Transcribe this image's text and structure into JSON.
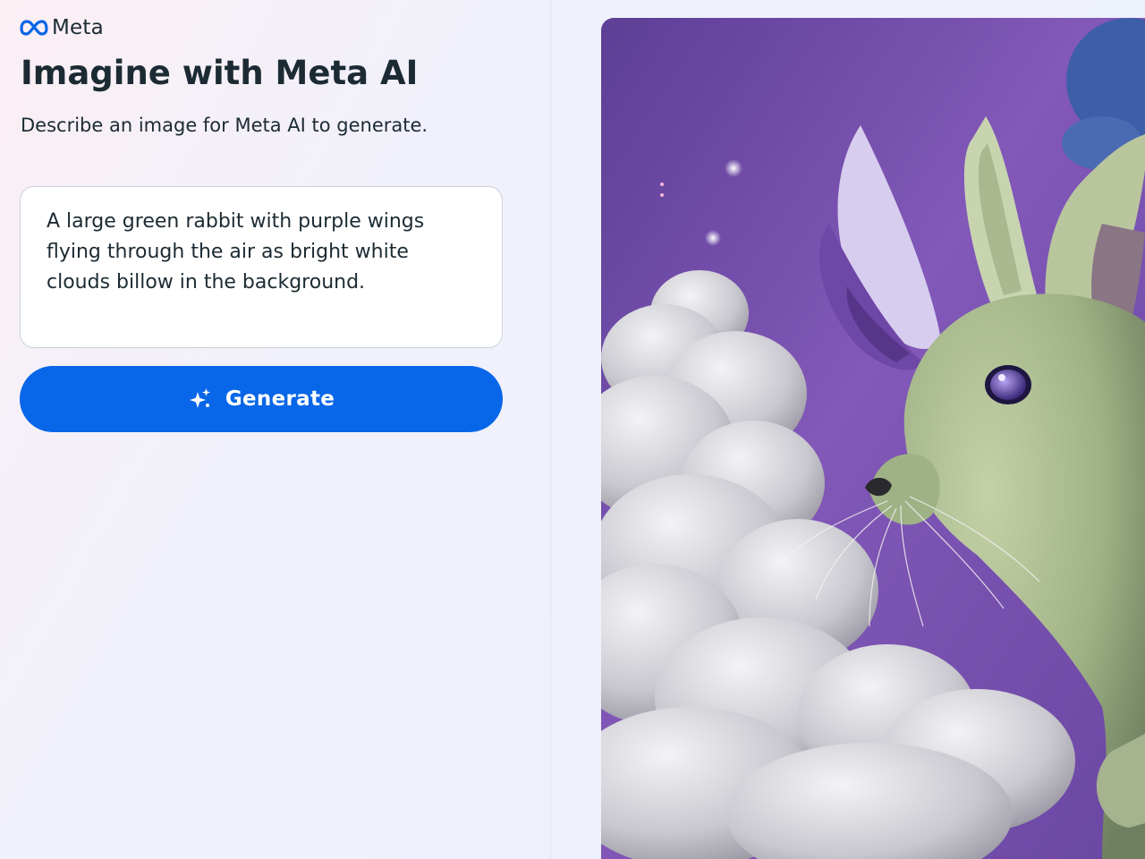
{
  "brand": {
    "name": "Meta",
    "logo_icon": "meta-infinity-logo-icon",
    "logo_color": "#0866e8"
  },
  "header": {
    "title": "Imagine with Meta AI",
    "subtitle": "Describe an image for Meta AI to generate."
  },
  "prompt": {
    "value": "A large green rabbit with purple wings flying through the air as bright white clouds billow in the background."
  },
  "generate_button": {
    "label": "Generate",
    "icon": "sparkle-icon",
    "color": "#0866e8"
  },
  "generated_image": {
    "subject": "green-rabbit-with-purple-wings-among-clouds"
  },
  "colors": {
    "text": "#1c2b33",
    "accent": "#0866e8",
    "sky_purple": "#7a4fb0"
  }
}
